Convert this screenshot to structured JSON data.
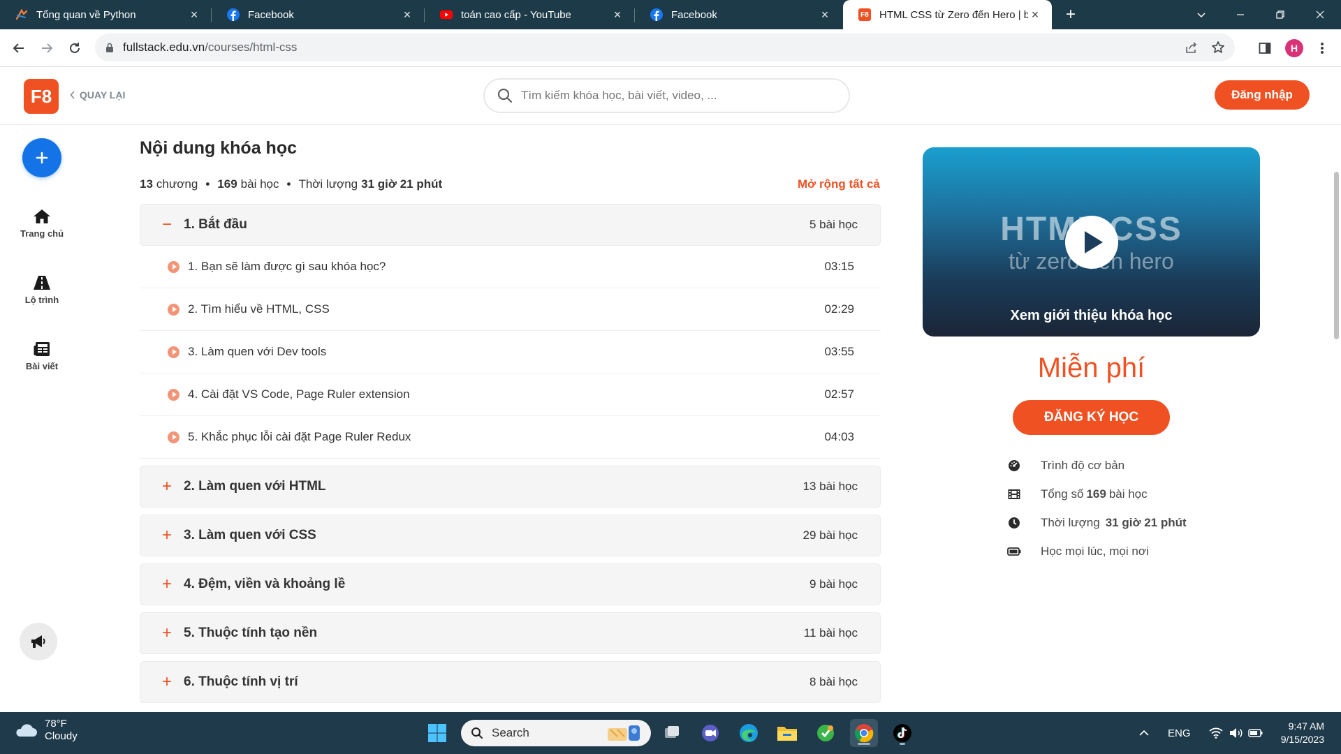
{
  "browser": {
    "tabs": [
      {
        "title": "Tổng quan về Python",
        "icon": "python-favicon",
        "active": false
      },
      {
        "title": "Facebook",
        "icon": "facebook-favicon",
        "active": false
      },
      {
        "title": "toán cao cấp - YouTube",
        "icon": "youtube-favicon",
        "active": false
      },
      {
        "title": "Facebook",
        "icon": "facebook-favicon",
        "active": false
      },
      {
        "title": "HTML CSS từ Zero đến Hero | by",
        "icon": "f8-favicon",
        "active": true
      }
    ],
    "favicon_f8_text": "F8",
    "new_tab": "+",
    "close_glyph": "×",
    "url_host": "fullstack.edu.vn",
    "url_path": "/courses/html-css",
    "profile_initial": "H",
    "colors": {
      "tabbar": "#1c3a48",
      "accent": "#f05123",
      "blue": "#1473e6"
    }
  },
  "header": {
    "logo": "F8",
    "back_label": "QUAY LẠI",
    "search_placeholder": "Tìm kiếm khóa học, bài viết, video, ...",
    "login_label": "Đăng nhập"
  },
  "sidebar": {
    "items": [
      {
        "label": "Trang chủ",
        "icon": "home-icon"
      },
      {
        "label": "Lộ trình",
        "icon": "road-icon"
      },
      {
        "label": "Bài viết",
        "icon": "newspaper-icon"
      }
    ]
  },
  "course": {
    "section_title": "Nội dung khóa học",
    "meta": {
      "chapters_num": "13",
      "chapters_word": "chương",
      "lessons_num": "169",
      "lessons_word": "bài học",
      "duration_label": "Thời lượng",
      "duration_value": "31 giờ 21 phút",
      "dot": "•"
    },
    "expand_all": "Mở rộng tất cả",
    "chapters": [
      {
        "title": "1. Bắt đầu",
        "count": "5 bài học",
        "expanded": true,
        "sign": "−",
        "lessons": [
          {
            "title": "1. Bạn sẽ làm được gì sau khóa học?",
            "time": "03:15"
          },
          {
            "title": "2. Tìm hiểu về HTML, CSS",
            "time": "02:29"
          },
          {
            "title": "3. Làm quen với Dev tools",
            "time": "03:55"
          },
          {
            "title": "4. Cài đặt VS Code, Page Ruler extension",
            "time": "02:57"
          },
          {
            "title": "5. Khắc phục lỗi cài đặt Page Ruler Redux",
            "time": "04:03"
          }
        ]
      },
      {
        "title": "2. Làm quen với HTML",
        "count": "13 bài học",
        "expanded": false,
        "sign": "+"
      },
      {
        "title": "3. Làm quen với CSS",
        "count": "29 bài học",
        "expanded": false,
        "sign": "+"
      },
      {
        "title": "4. Đệm, viền và khoảng lề",
        "count": "9 bài học",
        "expanded": false,
        "sign": "+"
      },
      {
        "title": "5. Thuộc tính tạo nền",
        "count": "11 bài học",
        "expanded": false,
        "sign": "+"
      },
      {
        "title": "6. Thuộc tính vị trí",
        "count": "8 bài học",
        "expanded": false,
        "sign": "+"
      }
    ]
  },
  "preview": {
    "title_line1": "HTML CSS",
    "title_line2": "từ zero đến hero",
    "caption": "Xem giới thiệu khóa học"
  },
  "pricing": {
    "price": "Miễn phí",
    "register_label": "ĐĂNG KÝ HỌC",
    "info": [
      {
        "icon": "gauge-icon",
        "pre": "Trình độ cơ bản",
        "bold": "",
        "post": ""
      },
      {
        "icon": "film-icon",
        "pre": "Tổng số",
        "bold": "169",
        "post": "bài học"
      },
      {
        "icon": "clock-icon",
        "pre": "Thời lượng",
        "bold": "31 giờ 21 phút",
        "post": ""
      },
      {
        "icon": "battery-icon",
        "pre": "Học mọi lúc, mọi nơi",
        "bold": "",
        "post": ""
      }
    ]
  },
  "taskbar": {
    "weather_temp": "78°F",
    "weather_desc": "Cloudy",
    "search_label": "Search",
    "language": "ENG",
    "time": "9:47 AM",
    "date": "9/15/2023"
  }
}
